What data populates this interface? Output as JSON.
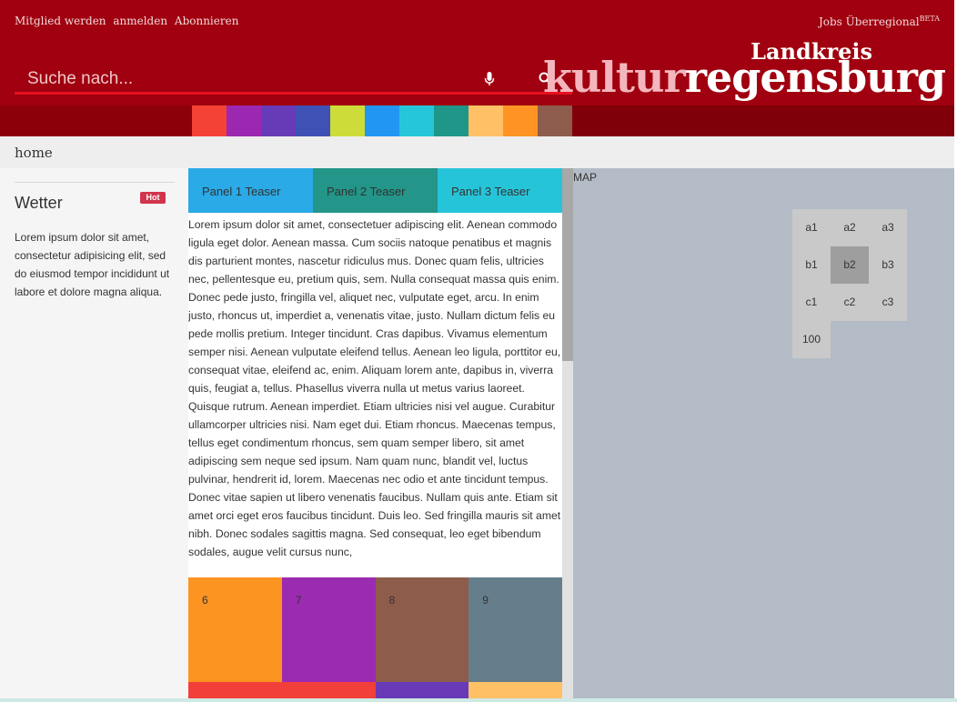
{
  "header": {
    "top_links": [
      "Mitglied werden",
      "anmelden",
      "Abonnieren"
    ],
    "jobs_label": "Jobs Überregional",
    "jobs_badge": "BETA",
    "search": {
      "placeholder": "Suche nach..."
    },
    "icons": {
      "mic": "microphone-icon",
      "search": "search-icon"
    },
    "logo": {
      "top": "Landkreis",
      "left": "kultur",
      "right": "regensburg"
    }
  },
  "color_swatches": [
    "#f44336",
    "#9c27b0",
    "#673ab7",
    "#3f51b5",
    "#cddc39",
    "#2196f3",
    "#26c6da",
    "#1e9688",
    "#ffc066",
    "#ff9424",
    "#8e5c4c"
  ],
  "breadcrumb": {
    "home": "home"
  },
  "sidebar": {
    "weather_title": "Wetter",
    "hot_badge": "Hot",
    "weather_text": "Lorem ipsum dolor sit amet, consectetur adipisicing elit, sed do eiusmod tempor incididunt ut labore et dolore magna aliqua."
  },
  "tabs": [
    {
      "label": "Panel 1 Teaser",
      "color": "#2aaae6"
    },
    {
      "label": "Panel 2 Teaser",
      "color": "#239589"
    },
    {
      "label": "Panel 3 Teaser",
      "color": "#26c4d9"
    }
  ],
  "article": "Lorem ipsum dolor sit amet, consectetuer adipiscing elit. Aenean commodo ligula eget dolor. Aenean massa. Cum sociis natoque penatibus et magnis dis parturient montes, nascetur ridiculus mus. Donec quam felis, ultricies nec, pellentesque eu, pretium quis, sem. Nulla consequat massa quis enim. Donec pede justo, fringilla vel, aliquet nec, vulputate eget, arcu. In enim justo, rhoncus ut, imperdiet a, venenatis vitae, justo. Nullam dictum felis eu pede mollis pretium. Integer tincidunt. Cras dapibus. Vivamus elementum semper nisi. Aenean vulputate eleifend tellus. Aenean leo ligula, porttitor eu, consequat vitae, eleifend ac, enim. Aliquam lorem ante, dapibus in, viverra quis, feugiat a, tellus. Phasellus viverra nulla ut metus varius laoreet. Quisque rutrum. Aenean imperdiet. Etiam ultricies nisi vel augue. Curabitur ullamcorper ultricies nisi. Nam eget dui. Etiam rhoncus. Maecenas tempus, tellus eget condimentum rhoncus, sem quam semper libero, sit amet adipiscing sem neque sed ipsum. Nam quam nunc, blandit vel, luctus pulvinar, hendrerit id, lorem. Maecenas nec odio et ante tincidunt tempus. Donec vitae sapien ut libero venenatis faucibus. Nullam quis ante. Etiam sit amet orci eget eros faucibus tincidunt. Duis leo. Sed fringilla mauris sit amet nibh. Donec sodales sagittis magna. Sed consequat, leo eget bibendum sodales, augue velit cursus nunc,",
  "tiles": [
    {
      "label": "6",
      "color": "#fb9421"
    },
    {
      "label": "7",
      "color": "#9b2bb0"
    },
    {
      "label": "8",
      "color": "#8d5c4b"
    },
    {
      "label": "9",
      "color": "#667d8b"
    }
  ],
  "tiles_row2": [
    "#f33f3a",
    "#f33f3a",
    "#683ab8",
    "#ffc066"
  ],
  "map": {
    "label": "MAP",
    "cells": [
      [
        "a1",
        "a2",
        "a3"
      ],
      [
        "b1",
        "b2",
        "b3"
      ],
      [
        "c1",
        "c2",
        "c3"
      ],
      [
        "100"
      ]
    ],
    "active": "b2"
  }
}
